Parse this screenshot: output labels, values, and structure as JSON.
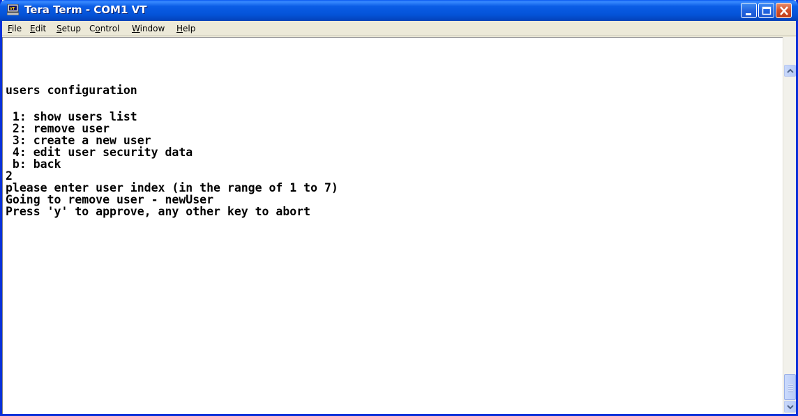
{
  "window": {
    "title": "Tera Term - COM1 VT",
    "title_color": "#ffffff",
    "titlebar_color": "#0453d8",
    "icons": {
      "app": "tera-term-icon",
      "minimize": "minimize-icon",
      "maximize": "maximize-icon",
      "close": "close-icon"
    }
  },
  "menu": {
    "items": [
      {
        "label_pre": "",
        "label_u": "F",
        "label_post": "ile"
      },
      {
        "label_pre": "",
        "label_u": "E",
        "label_post": "dit"
      },
      {
        "label_pre": "",
        "label_u": "S",
        "label_post": "etup"
      },
      {
        "label_pre": "C",
        "label_u": "o",
        "label_post": "ntrol"
      },
      {
        "label_pre": "",
        "label_u": "W",
        "label_post": "indow"
      },
      {
        "label_pre": "",
        "label_u": "H",
        "label_post": "elp"
      }
    ]
  },
  "terminal": {
    "lines": [
      "users configuration",
      "",
      " 1: show users list",
      " 2: remove user",
      " 3: create a new user",
      " 4: edit user security data",
      " b: back",
      "2",
      "please enter user index (in the range of 1 to 7)",
      "Going to remove user - newUser",
      "Press 'y' to approve, any other key to abort"
    ]
  },
  "scrollbar": {
    "up_icon": "scroll-up-arrow-icon",
    "down_icon": "scroll-down-arrow-icon",
    "grip_icon": "scroll-grip-icon"
  }
}
